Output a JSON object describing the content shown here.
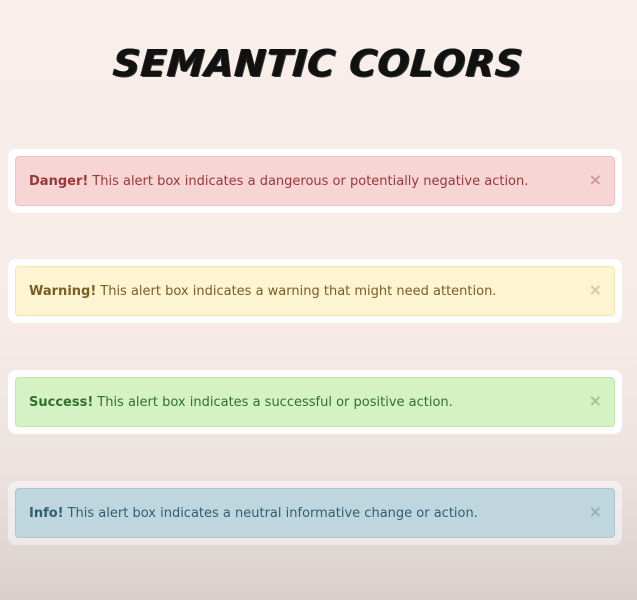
{
  "page": {
    "title": "SEMANTIC COLORS"
  },
  "alerts": [
    {
      "type": "danger",
      "strong": "Danger!",
      "message": "This alert box indicates a dangerous or potentially negative action.",
      "close": "×"
    },
    {
      "type": "warning",
      "strong": "Warning!",
      "message": "This alert box indicates a warning that might need attention.",
      "close": "×"
    },
    {
      "type": "success",
      "strong": "Success!",
      "message": "This alert box indicates a successful or positive action.",
      "close": "×"
    },
    {
      "type": "info",
      "strong": "Info!",
      "message": "This alert box indicates a neutral informative change or action.",
      "close": "×"
    }
  ],
  "colors": {
    "danger": "#f7d5d5",
    "warning": "#fdf4d2",
    "success": "#d4f2c4",
    "info": "#bfd6de"
  }
}
